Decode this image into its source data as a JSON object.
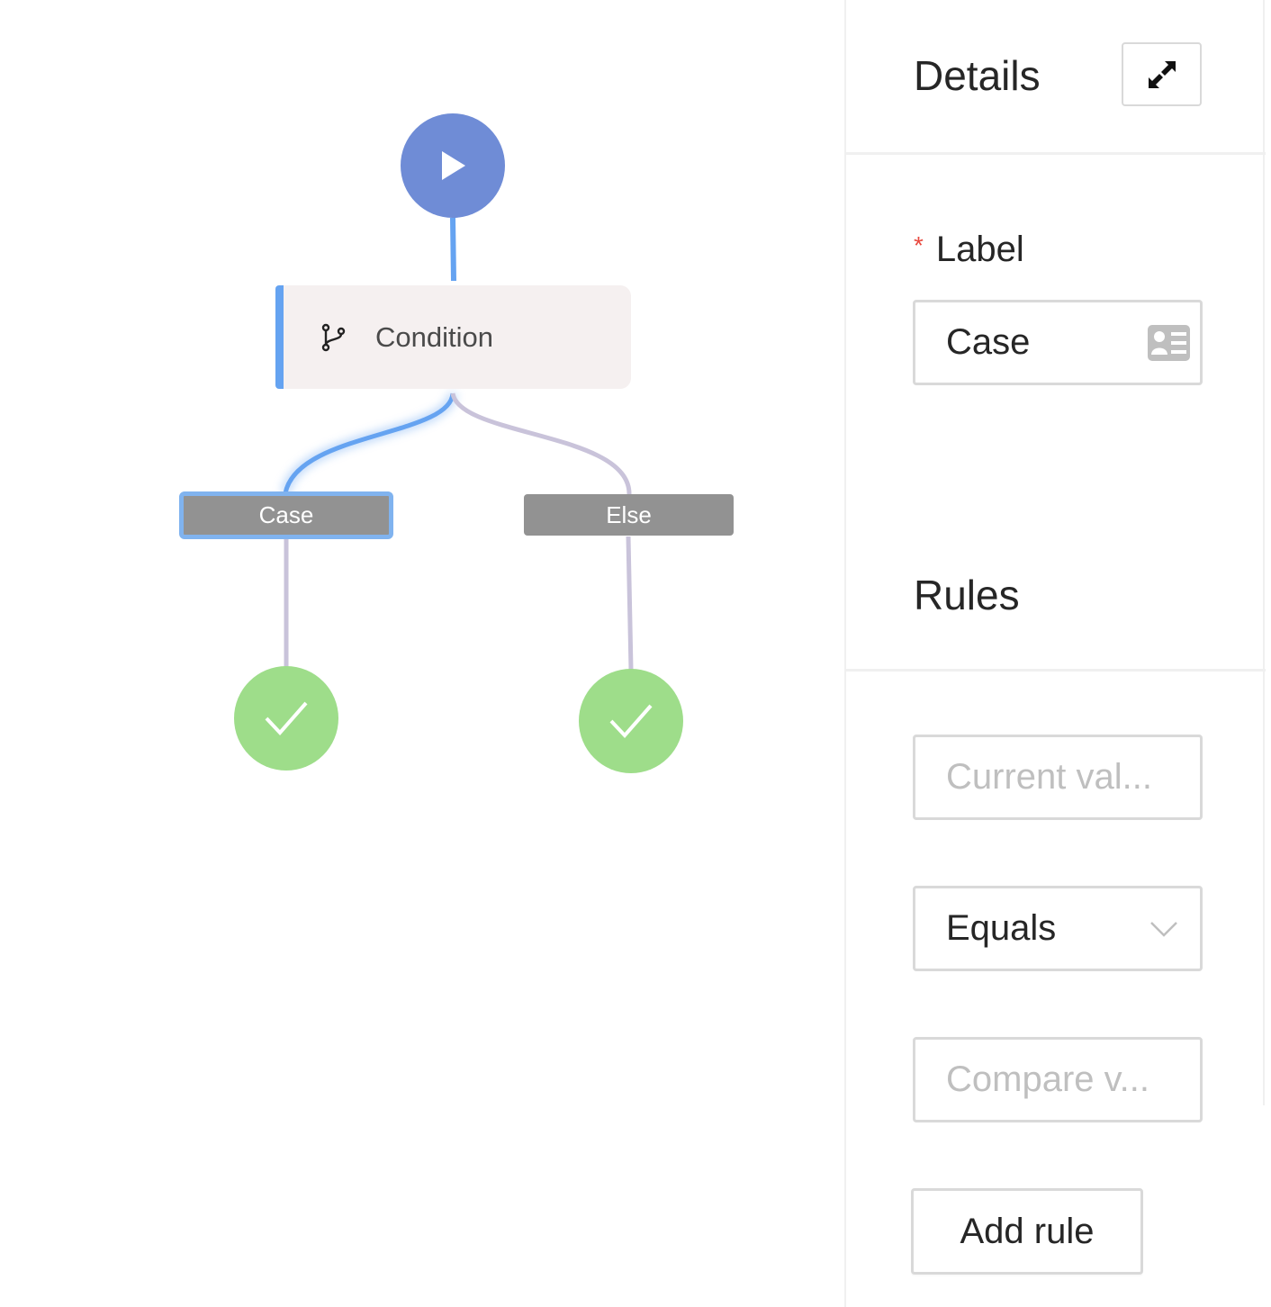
{
  "flow": {
    "start_node": {
      "icon": "play-icon"
    },
    "condition_node": {
      "icon": "branch-icon",
      "label": "Condition"
    },
    "branches": [
      {
        "label": "Case",
        "selected": true
      },
      {
        "label": "Else",
        "selected": false
      }
    ],
    "end_nodes": [
      {
        "icon": "check-icon"
      },
      {
        "icon": "check-icon"
      }
    ]
  },
  "panel": {
    "title": "Details",
    "expand_icon": "expand-icon",
    "label_field": {
      "required_mark": "*",
      "label": "Label",
      "value": "Case",
      "icon": "contact-card-icon"
    },
    "rules": {
      "title": "Rules",
      "current_value_placeholder": "Current val...",
      "operator": "Equals",
      "operator_icon": "chevron-down-icon",
      "compare_value_placeholder": "Compare v...",
      "add_rule_label": "Add rule"
    }
  },
  "colors": {
    "start_node": "#6f8cd6",
    "end_node": "#9edd8a",
    "active_edge": "#65a3f1",
    "inactive_edge": "#c9c3da",
    "branch_bg": "#929292",
    "required": "#e8493f"
  }
}
